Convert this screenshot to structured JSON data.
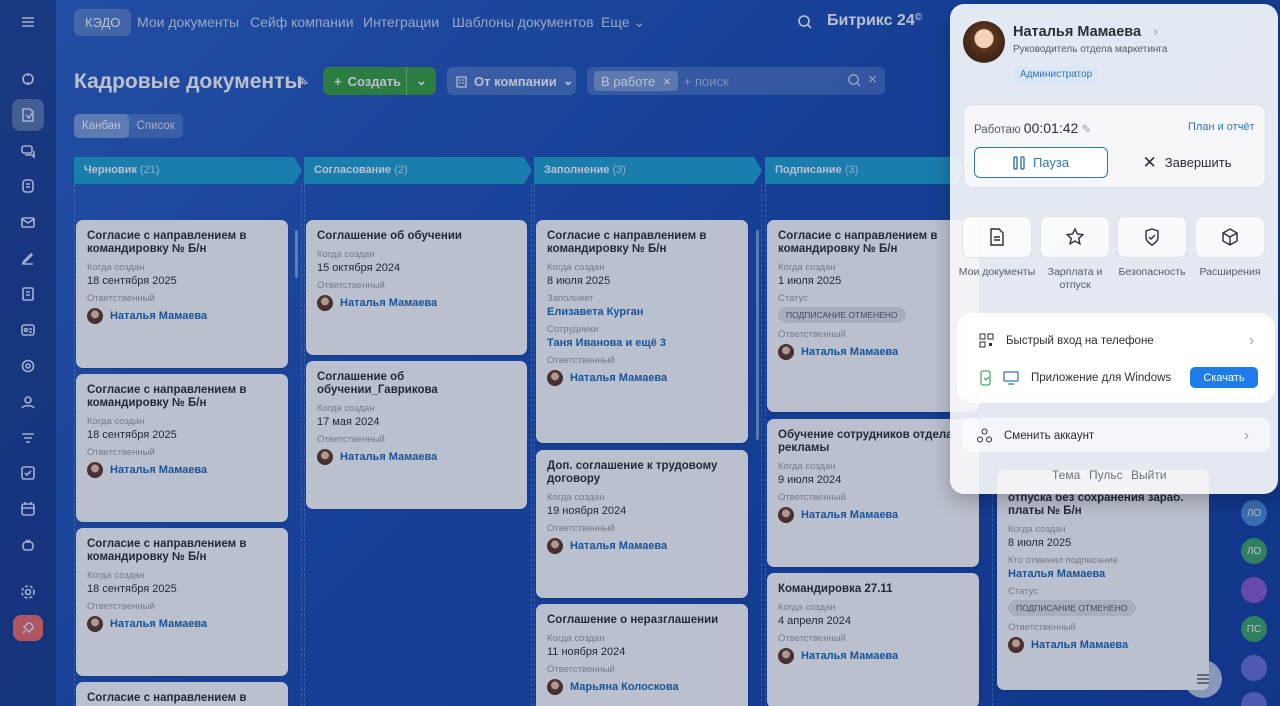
{
  "topbar": {
    "kedo": "КЭДО",
    "menu": [
      "Мои документы",
      "Сейф компании",
      "Интеграции",
      "Шаблоны документов",
      "Еще"
    ],
    "brand": "Битрикс 24"
  },
  "header": {
    "title": "Кадровые документы",
    "create_label": "Создать",
    "company_label": "От компании",
    "filter_chip": "В работе",
    "search_placeholder": "+ поиск",
    "views": [
      "Канбан",
      "Список"
    ]
  },
  "columns": [
    {
      "name": "Черновик",
      "count": "(21)",
      "color": "#22a6d6"
    },
    {
      "name": "Согласование",
      "count": "(2)",
      "color": "#22a6d6"
    },
    {
      "name": "Заполнение",
      "count": "(3)",
      "color": "#22a6d6"
    },
    {
      "name": "Подписание",
      "count": "(3)",
      "color": "#22a6d6"
    }
  ],
  "labels": {
    "created": "Когда создан",
    "responsible": "Ответственный",
    "filler": "Заполняет",
    "employees": "Сотрудники",
    "status": "Статус",
    "cancelled_by": "Кто отменил подписание"
  },
  "cards": {
    "c1": {
      "title": "Согласие с направлением в командировку № Б/н",
      "date": "18 сентября 2025",
      "person": "Наталья Мамаева"
    },
    "c2": {
      "title": "Согласие с направлением в командировку № Б/н",
      "date": "18 сентября 2025",
      "person": "Наталья Мамаева"
    },
    "c3": {
      "title": "Согласие с направлением в командировку № Б/н",
      "date": "18 сентября 2025",
      "person": "Наталья Мамаева"
    },
    "c4": {
      "title": "Согласие с направлением в"
    },
    "s1": {
      "title": "Соглашение об обучении",
      "date": "15 октября 2024",
      "person": "Наталья Мамаева"
    },
    "s2": {
      "title": "Соглашение об обучении_Гаврикова",
      "date": "17 мая 2024",
      "person": "Наталья Мамаева"
    },
    "f1": {
      "title": "Согласие с направлением в командировку № Б/н",
      "date": "8 июля 2025",
      "filler": "Елизавета Курган",
      "employees": "Таня Иванова и ещё 3",
      "person": "Наталья Мамаева"
    },
    "f2": {
      "title": "Доп. соглашение к трудовому договору",
      "date": "19 ноября 2024",
      "person": "Наталья Мамаева"
    },
    "f3": {
      "title": "Соглашение о неразглашении",
      "date": "11 ноября 2024",
      "person": "Марьяна Колоскова"
    },
    "p1": {
      "title": "Согласие с направлением в командировку № Б/н",
      "date": "1 июля 2025",
      "status": "ПОДПИСАНИЕ ОТМЕНЕНО",
      "person": "Наталья Мамаева"
    },
    "p2": {
      "title": "Обучение сотрудников отдела рекламы",
      "date": "9 июля 2024",
      "person": "Наталья Мамаева"
    },
    "p3": {
      "title": "Командировка 27.11",
      "date": "4 апреля 2024",
      "person": "Наталья Мамаева"
    },
    "q1": {
      "title": "отпуска без сохранения зараб. платы № Б/н",
      "date": "8 июля 2025",
      "cancelled_by": "Наталья Мамаева",
      "status": "ПОДПИСАНИЕ ОТМЕНЕНО",
      "person": "Наталья Мамаева"
    }
  },
  "right_avatars": [
    "ЛО",
    "ЛО",
    "",
    "ПС",
    ""
  ],
  "profile": {
    "name": "Наталья Мамаева",
    "position": "Руководитель отдела маркетинга",
    "role": "Администратор",
    "work_label": "Работаю",
    "work_time": "00:01:42",
    "plan_link": "План и отчёт",
    "pause_label": "Пауза",
    "finish_label": "Завершить",
    "tiles": [
      {
        "label": "Мои документы",
        "icon": "document-icon"
      },
      {
        "label": "Зарплата и отпуск",
        "icon": "star-icon"
      },
      {
        "label": "Безопасность",
        "icon": "shield-icon"
      },
      {
        "label": "Расширения",
        "icon": "box-icon"
      }
    ],
    "quick_login": "Быстрый вход на телефоне",
    "windows_app": "Приложение для Windows",
    "download": "Скачать",
    "switch_account": "Сменить аккаунт",
    "links": [
      "Тема",
      "Пульс",
      "Выйти"
    ]
  }
}
